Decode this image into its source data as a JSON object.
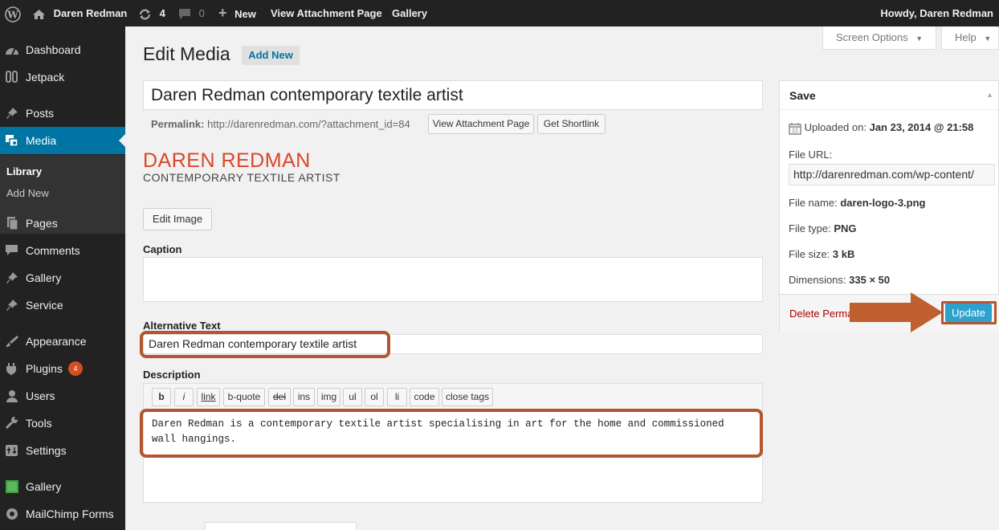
{
  "adminbar": {
    "site_name": "Daren Redman",
    "updates_count": "4",
    "comments_count": "0",
    "new_label": "New",
    "view_attachment": "View Attachment Page",
    "gallery": "Gallery",
    "howdy": "Howdy, Daren Redman"
  },
  "sidebar": {
    "items": [
      {
        "label": "Dashboard",
        "icon": "dashboard-icon"
      },
      {
        "label": "Jetpack",
        "icon": "jetpack-icon"
      },
      {
        "label": "Posts",
        "icon": "pin-icon"
      },
      {
        "label": "Media",
        "icon": "media-icon"
      },
      {
        "label": "Pages",
        "icon": "pages-icon"
      },
      {
        "label": "Comments",
        "icon": "comment-icon"
      },
      {
        "label": "Gallery",
        "icon": "pin-icon"
      },
      {
        "label": "Service",
        "icon": "pin-icon"
      },
      {
        "label": "Appearance",
        "icon": "brush-icon"
      },
      {
        "label": "Plugins",
        "icon": "plugin-icon",
        "badge": "4"
      },
      {
        "label": "Users",
        "icon": "users-icon"
      },
      {
        "label": "Tools",
        "icon": "wrench-icon"
      },
      {
        "label": "Settings",
        "icon": "settings-icon"
      },
      {
        "label": "Gallery",
        "icon": "gallery-square-icon"
      },
      {
        "label": "MailChimp Forms",
        "icon": "mail-icon"
      }
    ],
    "submenu": [
      "Library",
      "Add New"
    ]
  },
  "header": {
    "screen_options": "Screen Options",
    "help": "Help",
    "title": "Edit Media",
    "add_new": "Add New"
  },
  "main": {
    "title_value": "Daren Redman contemporary textile artist",
    "permalink_label": "Permalink:",
    "permalink_url": "http://darenredman.com/?attachment_id=84",
    "view_attachment_btn": "View Attachment Page",
    "shortlink_btn": "Get Shortlink",
    "logo_name": "DAREN REDMAN",
    "logo_tagline": "CONTEMPORARY TEXTILE ARTIST",
    "edit_image": "Edit Image",
    "caption_label": "Caption",
    "alt_label": "Alternative Text",
    "alt_value": "Daren Redman contemporary textile artist",
    "description_label": "Description",
    "quicktags": [
      "b",
      "i",
      "link",
      "b-quote",
      "del",
      "ins",
      "img",
      "ul",
      "ol",
      "li",
      "code",
      "close tags"
    ],
    "description_value": "Daren Redman is a contemporary textile artist specialising in art for the home and commissioned wall hangings."
  },
  "save_box": {
    "title": "Save",
    "uploaded_label": "Uploaded on:",
    "uploaded_value": "Jan 23, 2014 @ 21:58",
    "file_url_label": "File URL:",
    "file_url_value": "http://darenredman.com/wp-content/",
    "file_name_label": "File name:",
    "file_name_value": "daren-logo-3.png",
    "file_type_label": "File type:",
    "file_type_value": "PNG",
    "file_size_label": "File size:",
    "file_size_value": "3 kB",
    "dimensions_label": "Dimensions:",
    "dimensions_value": "335 × 50",
    "delete_label": "Delete Perma",
    "update_label": "Update"
  },
  "colors": {
    "accent": "#0074a2",
    "highlight": "#b5552f",
    "logo_red": "#d9472b",
    "update_blue": "#2ea2cc"
  }
}
